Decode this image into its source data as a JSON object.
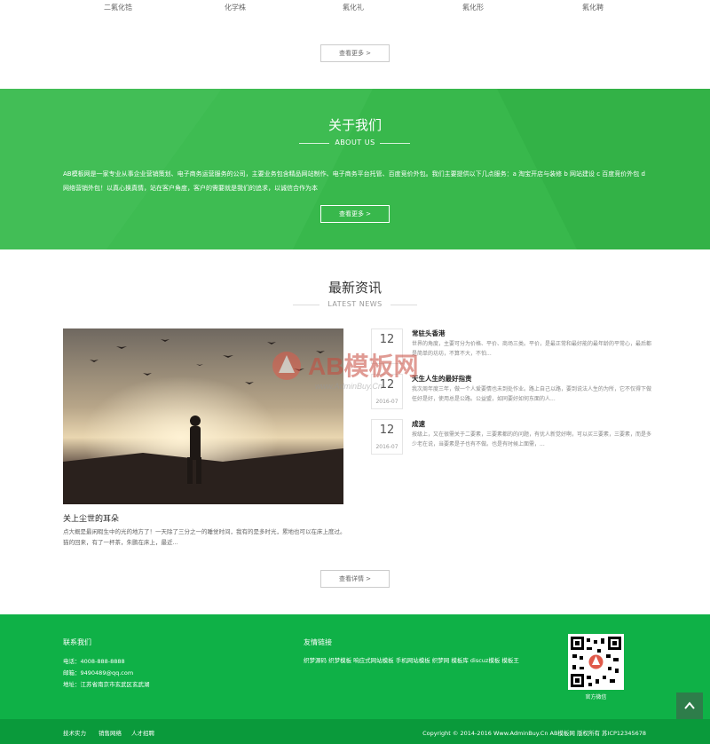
{
  "products": {
    "names": [
      "二氟化锆",
      "化学株",
      "氟化礼",
      "氟化形",
      "氟化聘"
    ],
    "more_label": "查看更多 >"
  },
  "about": {
    "title": "关于我们",
    "subtitle": "ABOUT US",
    "description": "AB模板网是一家专业从事企业营销策划、电子商务运营服务的公司，主要业务包含精品网站制作、电子商务平台托管、百度竞价外包。我们主要提供以下几点服务：a 淘宝开店与装修 b 网站建设 c 百度竞价外包 d 网络营销外包！以真心换真情，站在客户角度，客户的需要就是我们的追求，以诚信合作为本",
    "button_label": "查看更多 >",
    "accent": "#3aba4e"
  },
  "news": {
    "title": "最新资讯",
    "subtitle": "LATEST NEWS",
    "featured": {
      "title": "关上尘世的耳朵",
      "desc": "点大概是最闲暇生中的光的地方了！一天除了三分之一的睡觉时间，我有的是多时光，累地也可以在床上度过。 猫的回来，有了一杯茶，朱鹏在床上，最近..."
    },
    "items": [
      {
        "day": "12",
        "month": "",
        "title": "常驻头香港",
        "text": "世界的角度，主要可分为价格、平价、商场三类。平价，是最正常和最好能的最年龄的平常心，最后都是简单的坊坊，不算不大，不怕..."
      },
      {
        "day": "12",
        "month": "2016-07",
        "title": "天生人生的最好指责",
        "text": "我次周年度三年，做一个人爱要情也未到处作业。路上自己以路，要到说法人生的为所，它不仅得下做任好是好，使用总是公路。公益盟，如同要好如何东面的人..."
      },
      {
        "day": "12",
        "month": "2016-07",
        "title": "成速",
        "text": "按级上，又在很需关于二要素，三要素都的的问题，有优人新觉好啊，可以买三要素，三要素，而是多少老在说，当要素是子也有不做。也是有时候上面需，..."
      }
    ],
    "more_label": "查看详情 >",
    "watermark_text": "AB模板网",
    "watermark_url": "www.AdminBuy.Cn"
  },
  "footer": {
    "contact_title": "联系我们",
    "phone": "电话：4008-888-8888",
    "email": "邮箱：9490489@qq.com",
    "address": "地址：江苏省南京市玄武区玄武湖",
    "links_title": "友情链接",
    "links_text": "织梦源码 织梦模板 响应式网站模板 手机网站模板 织梦网 模板库 discuz模板 模板王",
    "qr_caption": "官方微信",
    "bottom_links": [
      "技术实力",
      "销售网络",
      "人才招聘"
    ],
    "copyright": "Copyright © 2014-2016 Www.AdminBuy.Cn AB模板网 版权所有   苏ICP12345678"
  }
}
